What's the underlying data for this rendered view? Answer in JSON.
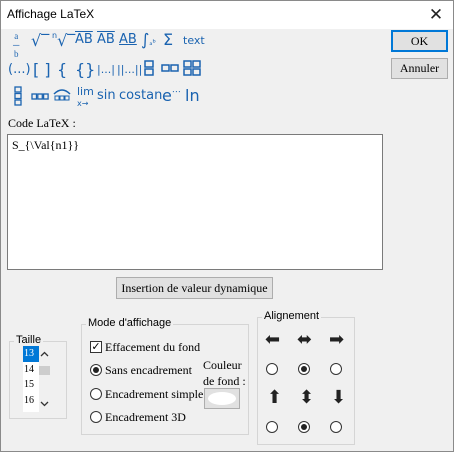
{
  "window": {
    "title": "Affichage LaTeX",
    "close_glyph": "✕"
  },
  "toolbar": {
    "row1": [
      {
        "name": "fraction-icon",
        "glyph": "a⁄b"
      },
      {
        "name": "sqrt-icon",
        "glyph": "√"
      },
      {
        "name": "nth-root-icon",
        "glyph": "ⁿ√"
      },
      {
        "name": "overline-arrow-icon",
        "glyph": "AB"
      },
      {
        "name": "overline-icon",
        "glyph": "AB"
      },
      {
        "name": "underline-icon",
        "glyph": "AB"
      },
      {
        "name": "integral-icon",
        "glyph": "∫ₐᵇ"
      },
      {
        "name": "sum-icon",
        "glyph": "Σ"
      },
      {
        "name": "text-icon",
        "glyph": "text"
      }
    ],
    "row2": [
      {
        "name": "parentheses-icon",
        "glyph": "(...)"
      },
      {
        "name": "brackets-icon",
        "glyph": "[ ]"
      },
      {
        "name": "brace-icon",
        "glyph": "{"
      },
      {
        "name": "braces-icon",
        "glyph": "{}"
      },
      {
        "name": "abs-icon",
        "glyph": "|...|"
      },
      {
        "name": "norm-icon",
        "glyph": "||...||"
      },
      {
        "name": "matrix-2x1-icon",
        "glyph": "▪▪"
      },
      {
        "name": "matrix-1x2-icon",
        "glyph": "▫▫"
      },
      {
        "name": "matrix-2x2-icon",
        "glyph": "▫▫"
      }
    ],
    "row3": [
      {
        "name": "matrix-3x1-icon",
        "glyph": "⋮"
      },
      {
        "name": "matrix-1x3-icon",
        "glyph": "▫▫▫"
      },
      {
        "name": "overbrace-icon",
        "glyph": "⌢"
      },
      {
        "name": "limit-icon",
        "glyph": "lim"
      },
      {
        "name": "sin-icon",
        "glyph": "sin"
      },
      {
        "name": "cos-icon",
        "glyph": "cos"
      },
      {
        "name": "tan-icon",
        "glyph": "tan"
      },
      {
        "name": "exp-icon",
        "glyph": "e⋯"
      },
      {
        "name": "ln-icon",
        "glyph": "ln"
      }
    ]
  },
  "buttons": {
    "ok": "OK",
    "cancel": "Annuler",
    "insert": "Insertion de valeur dynamique"
  },
  "code": {
    "label": "Code LaTeX :",
    "value": "S_{\\Val{n1}}"
  },
  "taille": {
    "title": "Taille",
    "items": [
      "13",
      "14",
      "15",
      "16"
    ],
    "selected": "13"
  },
  "mode": {
    "title": "Mode d'affichage",
    "erase_label": "Effacement du fond",
    "erase_checked": true,
    "options": [
      "Sans encadrement",
      "Encadrement simple",
      "Encadrement 3D"
    ],
    "selected": "Sans encadrement",
    "color_label_1": "Couleur",
    "color_label_2": "de fond :"
  },
  "alignement": {
    "title": "Alignement",
    "horizontal_selected": "center",
    "vertical_selected": "center"
  }
}
